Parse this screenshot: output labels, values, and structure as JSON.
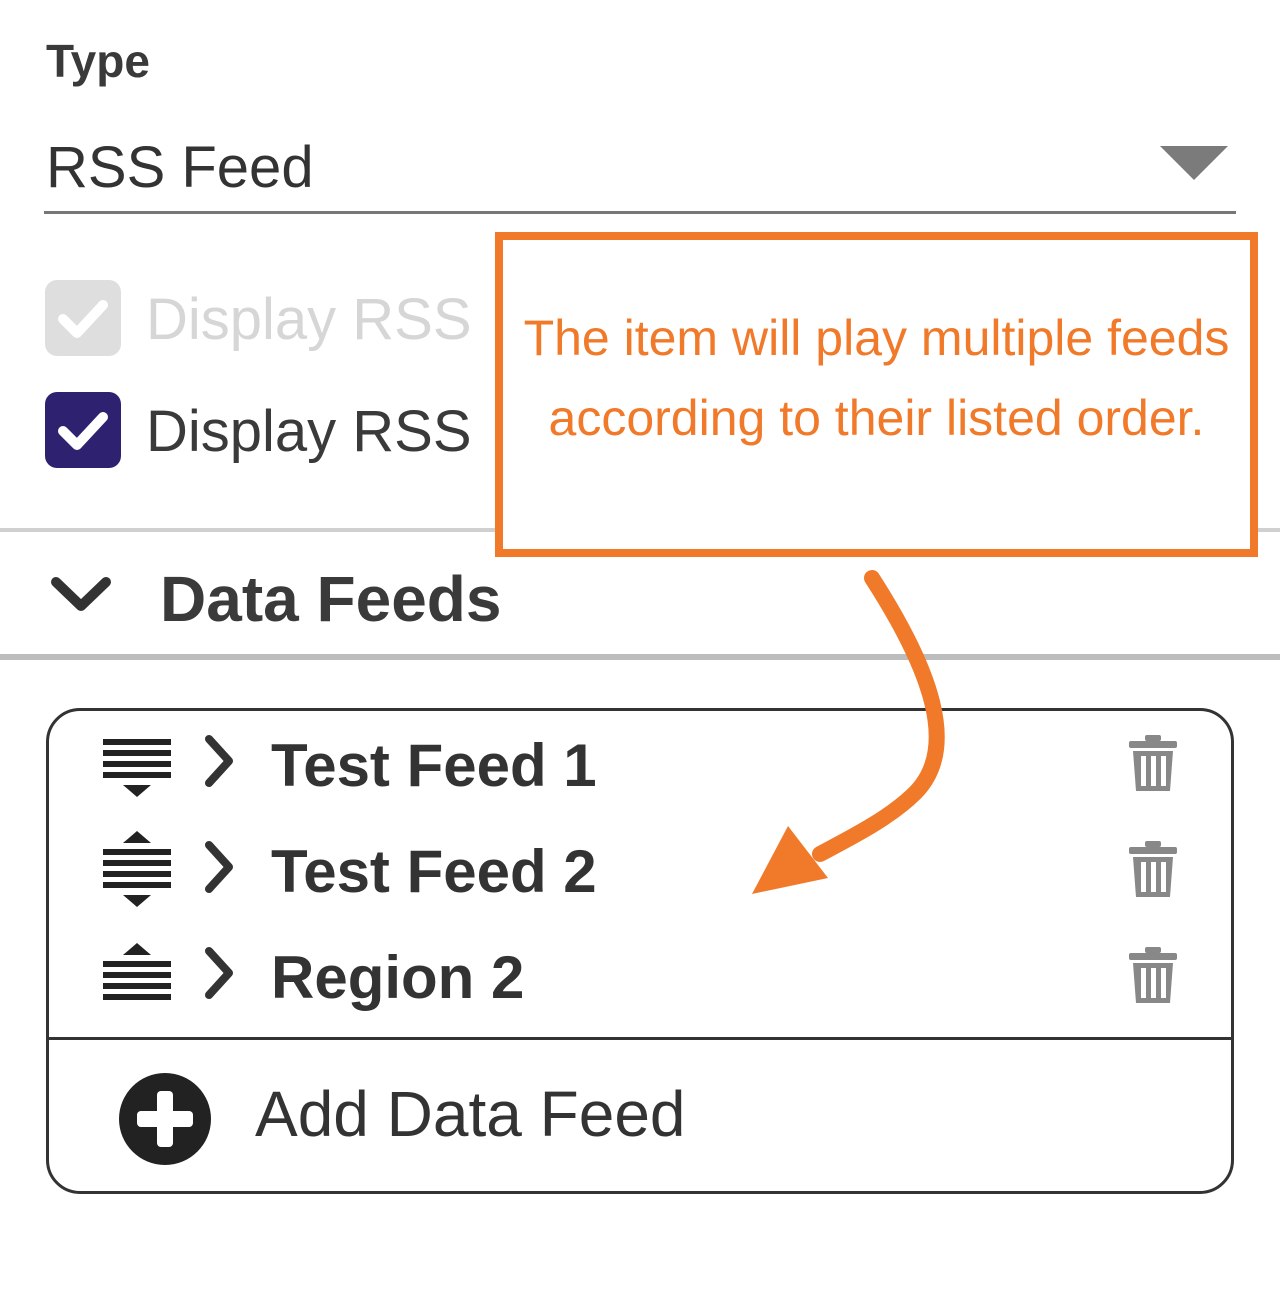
{
  "type_field": {
    "label": "Type",
    "value": "RSS Feed"
  },
  "checkboxes": [
    {
      "label": "Display RSS",
      "checked": true,
      "disabled": true
    },
    {
      "label": "Display RSS",
      "checked": true,
      "disabled": false
    }
  ],
  "section": {
    "title": "Data Feeds",
    "expanded": true
  },
  "feeds": [
    {
      "name": "Test Feed 1",
      "order_icon": "move-down-icon"
    },
    {
      "name": "Test Feed 2",
      "order_icon": "move-up-down-icon"
    },
    {
      "name": "Region 2",
      "order_icon": "move-up-icon"
    }
  ],
  "add_feed_label": "Add Data Feed",
  "callout": {
    "text": "The item will play multiple feeds according to their listed order."
  },
  "colors": {
    "accent": "#f07a2a",
    "checkbox_checked": "#2e2270",
    "checkbox_disabled": "#dedede"
  }
}
